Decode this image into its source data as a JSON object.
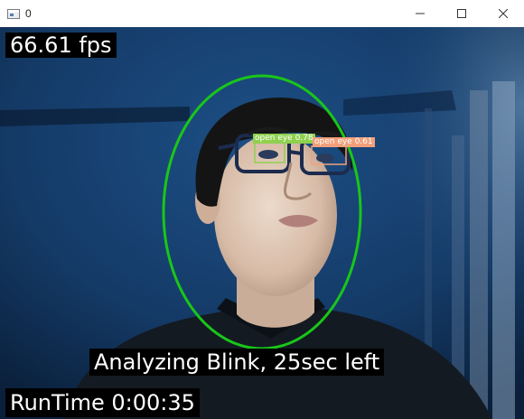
{
  "window": {
    "title": "0",
    "controls": {
      "minimize": "minimize-icon",
      "maximize": "maximize-icon",
      "close": "close-icon"
    }
  },
  "overlay": {
    "fps": "66.61 fps",
    "status": "Analyzing Blink, 25sec left",
    "runtime": "RunTime 0:00:35"
  },
  "detections": [
    {
      "label": "open eye 0.78",
      "color": "#8fd14f"
    },
    {
      "label": "open eye 0.61",
      "color": "#f2a07b"
    }
  ],
  "colors": {
    "face_ellipse": "#19c619",
    "background": "#0f2d4f",
    "label_text": "#ffffff"
  }
}
